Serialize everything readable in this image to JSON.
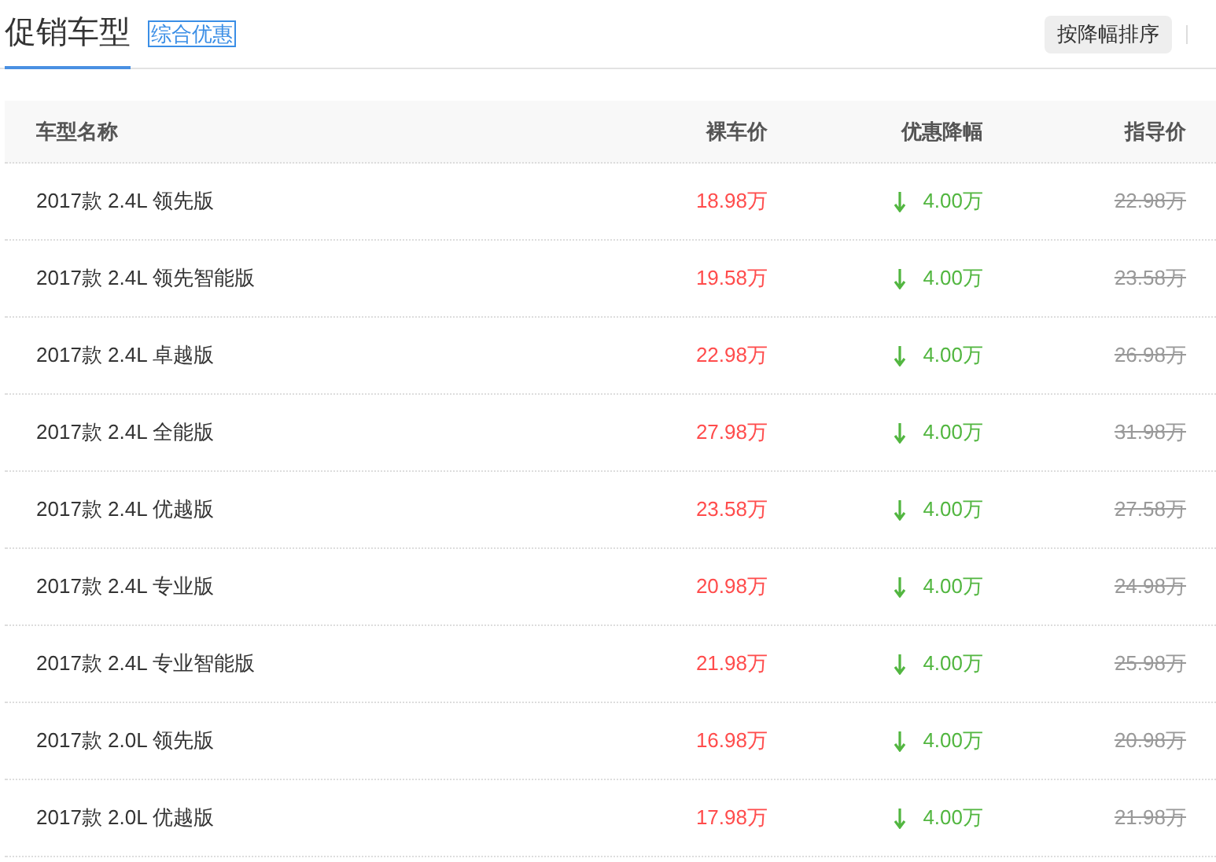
{
  "tabs": [
    {
      "label": "促销车型",
      "selected": true
    }
  ],
  "badge": "综合优惠",
  "sort_button": "按降幅排序",
  "table": {
    "columns": [
      "车型名称",
      "裸车价",
      "优惠降幅",
      "指导价"
    ],
    "rows": [
      {
        "name": "2017款 2.4L 领先版",
        "price": "18.98万",
        "discount": "4.00万",
        "guide": "22.98万"
      },
      {
        "name": "2017款 2.4L 领先智能版",
        "price": "19.58万",
        "discount": "4.00万",
        "guide": "23.58万"
      },
      {
        "name": "2017款 2.4L 卓越版",
        "price": "22.98万",
        "discount": "4.00万",
        "guide": "26.98万"
      },
      {
        "name": "2017款 2.4L 全能版",
        "price": "27.98万",
        "discount": "4.00万",
        "guide": "31.98万"
      },
      {
        "name": "2017款 2.4L 优越版",
        "price": "23.58万",
        "discount": "4.00万",
        "guide": "27.58万"
      },
      {
        "name": "2017款 2.4L 专业版",
        "price": "20.98万",
        "discount": "4.00万",
        "guide": "24.98万"
      },
      {
        "name": "2017款 2.4L 专业智能版",
        "price": "21.98万",
        "discount": "4.00万",
        "guide": "25.98万"
      },
      {
        "name": "2017款 2.0L 领先版",
        "price": "16.98万",
        "discount": "4.00万",
        "guide": "20.98万"
      },
      {
        "name": "2017款 2.0L 优越版",
        "price": "17.98万",
        "discount": "4.00万",
        "guide": "21.98万"
      }
    ]
  }
}
